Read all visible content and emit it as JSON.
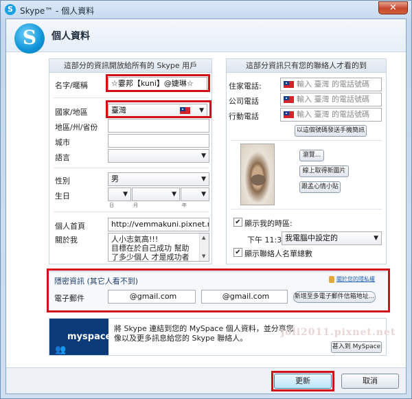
{
  "window": {
    "title": "Skype™ - 個人資料",
    "close": "✕"
  },
  "header": {
    "title": "個人資料",
    "logo_letter": "S"
  },
  "left_panel": {
    "heading": "這部分的資訊開放給所有的 Skype 用戶",
    "name_label": "名字/暱稱",
    "name_value": "☆霎邦【kuni】@婕琳☆",
    "country_label": "國家/地區",
    "country_value": "臺灣",
    "region_label": "地區/州/省份",
    "city_label": "城市",
    "language_label": "語言",
    "gender_label": "性別",
    "gender_value": "男",
    "birthday_label": "生日",
    "birthday_units": [
      "日",
      "月",
      "年"
    ],
    "homepage_label": "個人首頁",
    "homepage_value": "http://vemmakuni.pixnet.net/blog",
    "about_label": "關於我",
    "about_lines": [
      "人小志氣高!!!",
      "目標在於自己成功  幫助",
      "了多少個人  才是成功者"
    ]
  },
  "right_panel": {
    "heading": "這部分資訊只有您的聯絡人才看的到",
    "phones": [
      {
        "label": "住家電話:",
        "placeholder": "輸入 臺灣 的電話號碼"
      },
      {
        "label": "公司電話",
        "placeholder": "輸入 臺灣 的電話號碼"
      },
      {
        "label": "行動電話",
        "placeholder": "輸入 臺灣 的電話號碼"
      }
    ],
    "verify_mobile_button": "以這個號碼發送手機簡訊",
    "browse_button": "瀏覽...",
    "online_photo_button": "線上取得新圖片",
    "cute_button": "跟孟心情小貼",
    "show_time_label": "顯示我的時區:",
    "time_value": "下午 11:33",
    "timezone_value": "我電腦中設定的",
    "show_contacts_label": "顯示聯絡人名單總數"
  },
  "privacy": {
    "heading": "隱密資訊 (其它人看不到)",
    "lock_link": "關於您的隱私權",
    "email_label": "電子郵件",
    "email1": "@gmail.com",
    "email2": "@gmail.com",
    "add_email_button": "新增至多電子郵件信箱地址..."
  },
  "myspace": {
    "logo": "myspace.",
    "text_line1": "將 Skype 連結到您的 MySpace 個人資料，並分享您",
    "text_line2": "像以及更多訊息給您的 Skype 聯絡人。",
    "join_button": "甚入到 MySpace",
    "watermark": "joli2011.pixnet.net"
  },
  "footer": {
    "update_button": "更新",
    "cancel_button": "取消"
  },
  "colors": {
    "highlight_red": "#d20f18",
    "accent_blue": "#1aa1e1"
  }
}
